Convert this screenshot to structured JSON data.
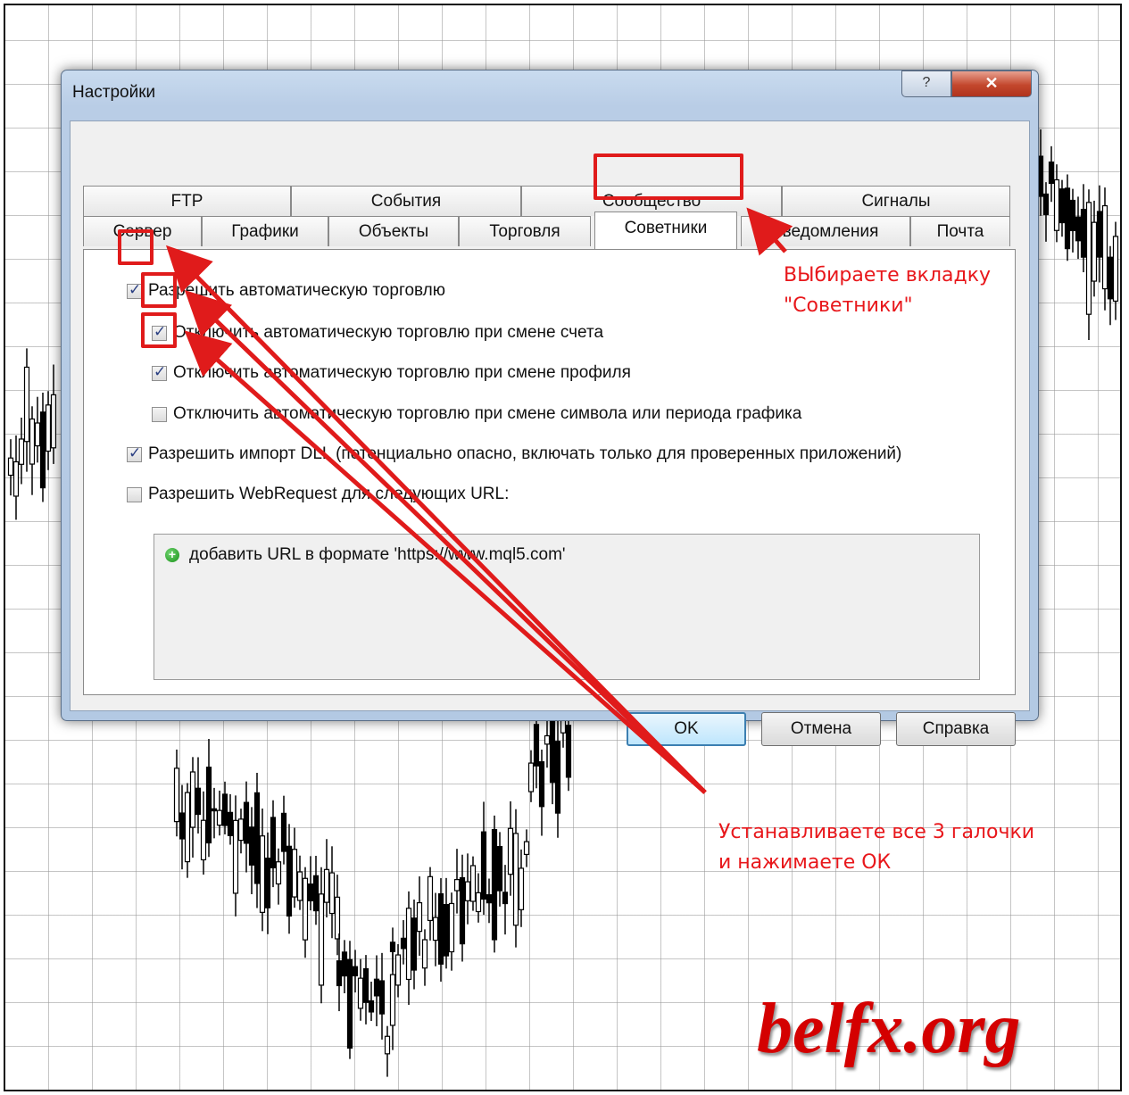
{
  "dialog": {
    "title": "Настройки",
    "help_glyph": "?",
    "close_glyph": "✕"
  },
  "tabs": {
    "row1": [
      "FTP",
      "События",
      "Сообщество",
      "Сигналы"
    ],
    "row2": [
      "Сервер",
      "Графики",
      "Объекты",
      "Торговля",
      "Советники",
      "Уведомления",
      "Почта"
    ],
    "active": "Советники"
  },
  "options": [
    {
      "label": "Разрешить автоматическую торговлю",
      "checked": true
    },
    {
      "label": "Отключить автоматическую торговлю при смене счета",
      "checked": true
    },
    {
      "label": "Отключить автоматическую торговлю при смене профиля",
      "checked": true
    },
    {
      "label": "Отключить автоматическую торговлю при смене символа или периода графика",
      "checked": false
    },
    {
      "label": "Разрешить импорт DLL (потенциально опасно, включать только для проверенных приложений)",
      "checked": true
    },
    {
      "label": "Разрешить WebRequest для следующих URL:",
      "checked": false
    }
  ],
  "url_list": {
    "add_label": "добавить URL в формате 'https://www.mql5.com'"
  },
  "buttons": {
    "ok": "OK",
    "cancel": "Отмена",
    "help": "Справка"
  },
  "annotations": {
    "tab_hint_line1": "ВЫбираете вкладку",
    "tab_hint_line2": "\"Советники\"",
    "checks_hint_line1": "Устанавливаете все 3 галочки",
    "checks_hint_line2": "и нажимаете ОК",
    "color": "#e01b1b"
  },
  "watermark": "belfx.org"
}
